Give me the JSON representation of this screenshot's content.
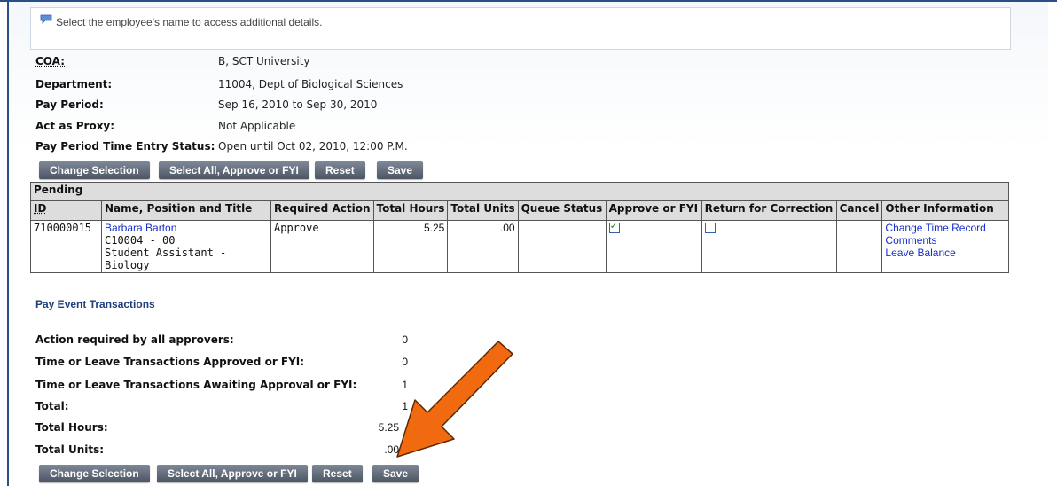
{
  "info": {
    "message": "Select the employee's name to access additional details."
  },
  "details": [
    {
      "label": "COA:",
      "value": "B, SCT University"
    },
    {
      "label": "Department:",
      "value": "11004, Dept of Biological Sciences"
    },
    {
      "label": "Pay Period:",
      "value": "Sep 16, 2010 to Sep 30, 2010"
    },
    {
      "label": "Act as Proxy:",
      "value": "Not Applicable"
    },
    {
      "label": "Pay Period Time Entry Status:",
      "value": "Open until Oct 02, 2010, 12:00 P.M."
    }
  ],
  "buttons": {
    "change_selection": "Change Selection",
    "select_all": "Select All, Approve or FYI",
    "reset": "Reset",
    "save": "Save"
  },
  "pending": {
    "caption": "Pending",
    "columns": [
      "ID",
      "Name, Position and Title",
      "Required Action",
      "Total Hours",
      "Total Units",
      "Queue Status",
      "Approve or FYI",
      "Return for Correction",
      "Cancel",
      "Other Information"
    ],
    "rows": [
      {
        "id": "710000015",
        "name": "Barbara Barton",
        "position": "C10004 - 00",
        "title": "Student Assistant - Biology",
        "required_action": "Approve",
        "total_hours": "5.25",
        "total_units": ".00",
        "queue_status": "",
        "approve_checked": true,
        "return_checked": false,
        "cancel": "",
        "links": [
          "Change Time Record",
          "Comments",
          "Leave Balance"
        ]
      }
    ]
  },
  "pay_event": {
    "title": "Pay Event Transactions",
    "summary": [
      {
        "label": "Action required by all approvers:",
        "value": "0"
      },
      {
        "label": "Time or Leave Transactions Approved or FYI:",
        "value": "0"
      },
      {
        "label": "Time or Leave Transactions Awaiting Approval or FYI:",
        "value": "1"
      },
      {
        "label": "Total:",
        "value": "1"
      },
      {
        "label": "Total Hours:",
        "value": "5.25"
      },
      {
        "label": "Total Units:",
        "value": ".00"
      }
    ]
  },
  "colors": {
    "accent_arrow": "#f26a10",
    "button": "#5a6372",
    "link": "#1730c8",
    "section_title": "#1e3f7a"
  }
}
